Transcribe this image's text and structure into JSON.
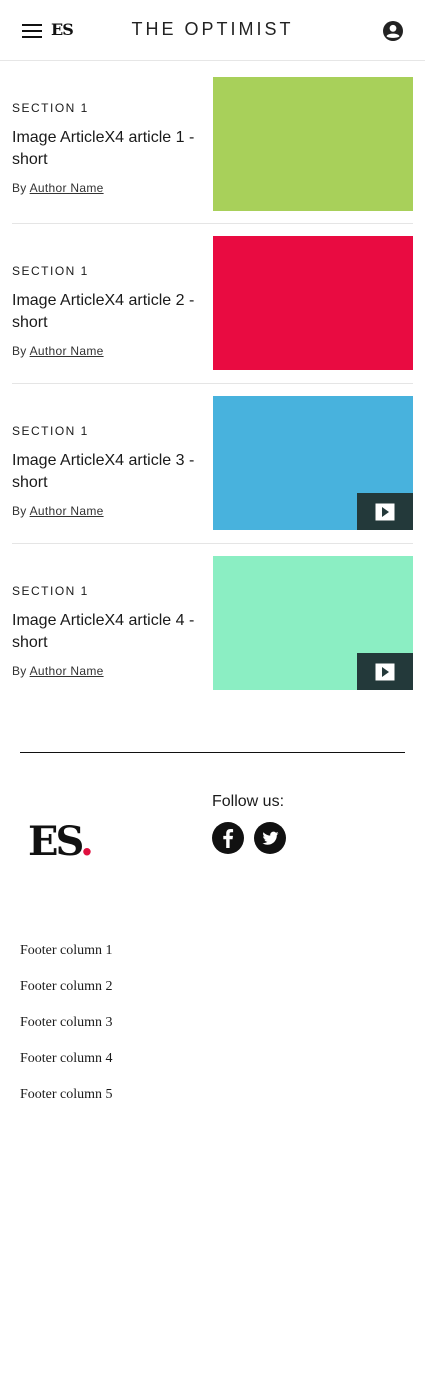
{
  "header": {
    "logo_text": "ES",
    "brand_title": "THE OPTIMIST",
    "menu_icon": "hamburger-menu-icon",
    "account_icon": "account-circle-icon"
  },
  "articles": [
    {
      "section": "SECTION 1",
      "title": "Image ArticleX4 article 1 - short",
      "by": "By",
      "author": "Author Name",
      "thumb_color": "#a8d05a",
      "video": false
    },
    {
      "section": "SECTION 1",
      "title": "Image ArticleX4 article 2 - short",
      "by": "By",
      "author": "Author Name",
      "thumb_color": "#e90b41",
      "video": false
    },
    {
      "section": "SECTION 1",
      "title": "Image ArticleX4 article 3 - short",
      "by": "By",
      "author": "Author Name",
      "thumb_color": "#48b2dd",
      "video": true
    },
    {
      "section": "SECTION 1",
      "title": "Image ArticleX4 article 4 - short",
      "by": "By",
      "author": "Author Name",
      "thumb_color": "#8beec3",
      "video": true
    }
  ],
  "footer": {
    "logo_text": "ES",
    "logo_dot": ".",
    "logo_dot_color": "#e0103f",
    "follow_label": "Follow us:",
    "social": [
      "facebook-icon",
      "twitter-icon"
    ],
    "columns": [
      "Footer column 1",
      "Footer column 2",
      "Footer column 3",
      "Footer column 4",
      "Footer column 5"
    ]
  }
}
